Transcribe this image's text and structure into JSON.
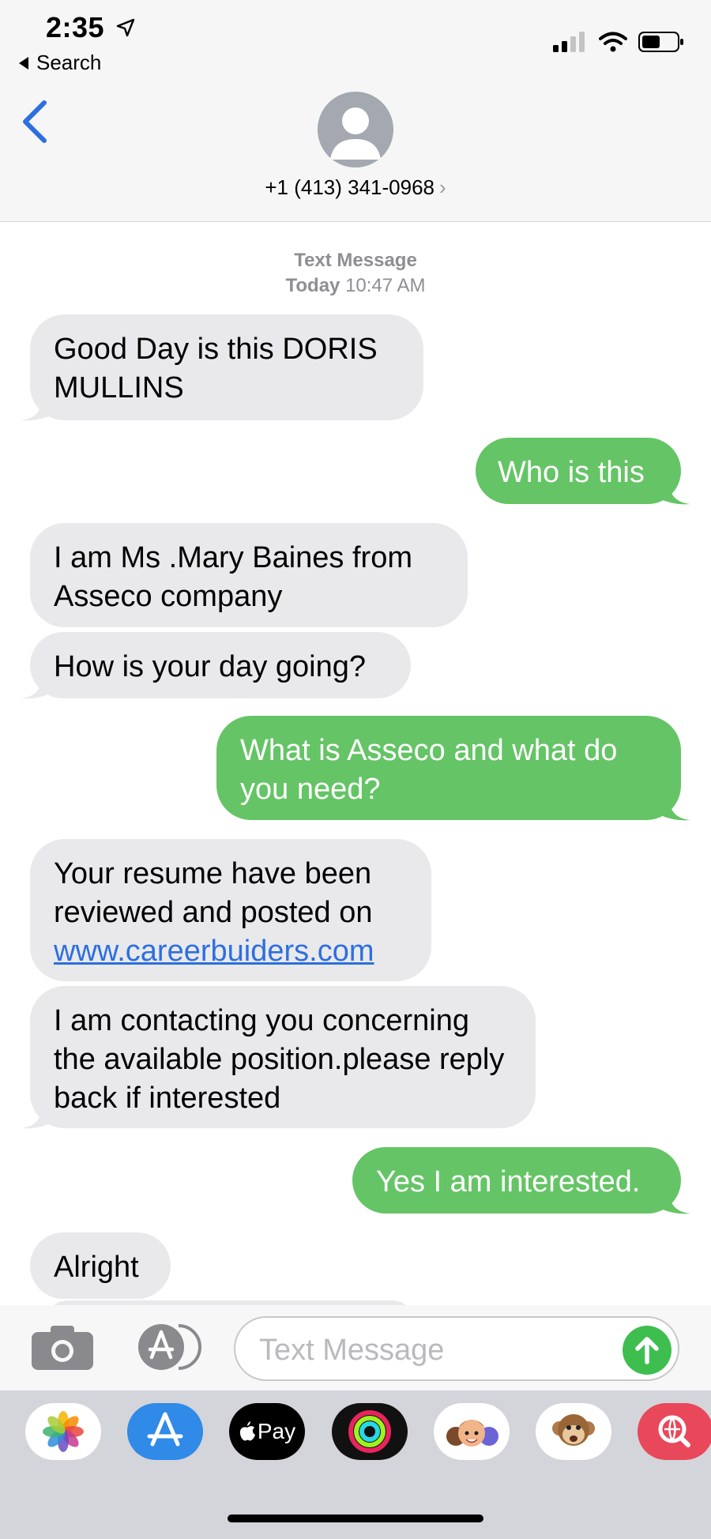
{
  "status_bar": {
    "time": "2:35",
    "back_app": "Search"
  },
  "header": {
    "contact": "+1 (413) 341-0968",
    "chevron": "›"
  },
  "thread": {
    "timestamp_title": "Text Message",
    "timestamp_day": "Today",
    "timestamp_time": "10:47 AM",
    "messages": [
      {
        "from": "them",
        "text": "Good Day is this DORIS MULLINS"
      },
      {
        "from": "me",
        "text": "Who is this"
      },
      {
        "from": "them",
        "text": "I am Ms .Mary Baines from Asseco company"
      },
      {
        "from": "them",
        "text": "How is your day going?"
      },
      {
        "from": "me",
        "text": "What is Asseco and what do you need?"
      },
      {
        "from": "them",
        "text_before_link": "Your resume have been reviewed and posted on ",
        "link": "www.careerbuiders.com"
      },
      {
        "from": "them",
        "text": "I am contacting you concerning the available position.please reply back if interested"
      },
      {
        "from": "me",
        "text": "Yes I am interested."
      },
      {
        "from": "them",
        "text": "Alright"
      }
    ]
  },
  "compose": {
    "placeholder": "Text Message"
  },
  "apps": {
    "apple_pay_label": "Pay"
  },
  "colors": {
    "incoming": "#e9e9eb",
    "outgoing": "#65c466",
    "accent": "#2c6fe0",
    "send": "#3fbe50"
  },
  "icons": [
    "location-arrow-icon",
    "signal-icon",
    "wifi-icon",
    "battery-icon",
    "chevron-left-icon",
    "person-icon",
    "camera-icon",
    "app-store-icon",
    "send-arrow-icon",
    "photos-icon",
    "apple-pay-icon",
    "activity-icon",
    "memoji-icon",
    "monkey-icon",
    "web-search-icon"
  ]
}
